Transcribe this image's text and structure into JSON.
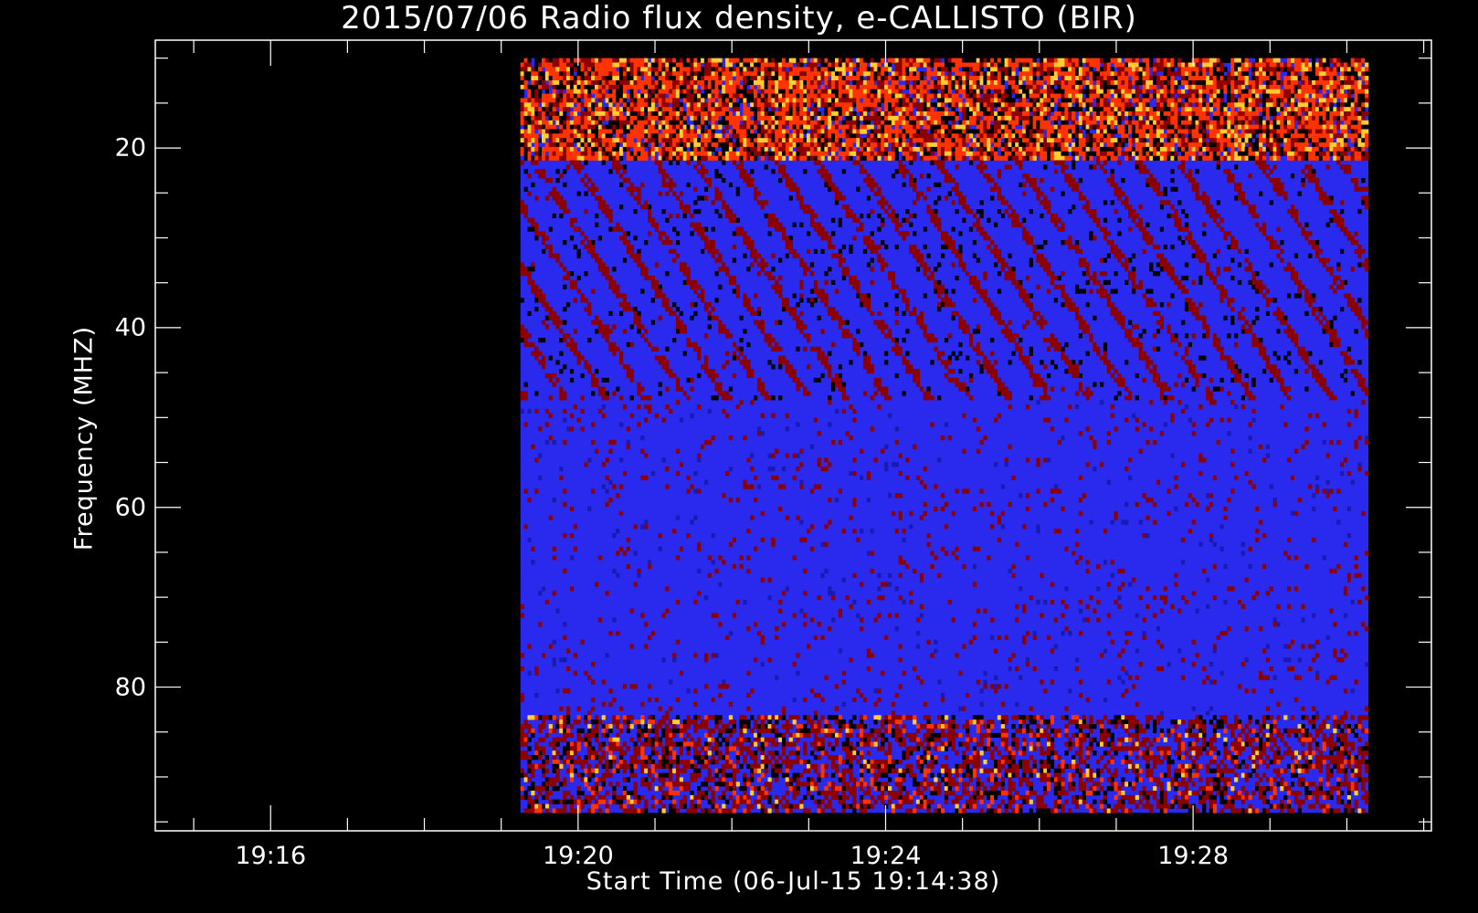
{
  "chart_data": {
    "type": "heatmap",
    "title": "2015/07/06  Radio flux density, e-CALLISTO (BIR)",
    "xlabel": "Start Time (06-Jul-15 19:14:38)",
    "ylabel": "Frequency (MHZ)",
    "x_start_minutes": 19.25,
    "x_end_minutes": 30.28,
    "xlim_minutes": [
      14.5,
      31.1
    ],
    "ylim": [
      96,
      8
    ],
    "freq_range": [
      10,
      94
    ],
    "x_ticks": [
      {
        "label": "19:16",
        "minutes": 16
      },
      {
        "label": "19:20",
        "minutes": 20
      },
      {
        "label": "19:24",
        "minutes": 24
      },
      {
        "label": "19:28",
        "minutes": 28
      }
    ],
    "y_ticks": [
      {
        "label": "20",
        "value": 20
      },
      {
        "label": "40",
        "value": 40
      },
      {
        "label": "60",
        "value": 60
      },
      {
        "label": "80",
        "value": 80
      }
    ],
    "colormap": [
      "#000000",
      "#0000ff",
      "#8b0000",
      "#ff3300",
      "#ffcc33"
    ],
    "background_color": "#2a2aee",
    "features": [
      {
        "name": "interference-band-top",
        "freq_range": [
          10,
          21
        ],
        "intensity": "high"
      },
      {
        "name": "diagonal-striations",
        "freq_range": [
          21,
          48
        ],
        "intensity": "medium"
      },
      {
        "name": "interference-band-bottom",
        "freq_range": [
          83,
          94
        ],
        "intensity": "high"
      }
    ]
  }
}
